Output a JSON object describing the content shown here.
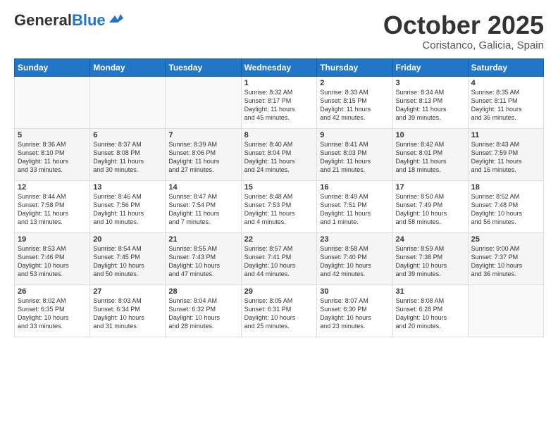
{
  "logo": {
    "general": "General",
    "blue": "Blue"
  },
  "header": {
    "month": "October 2025",
    "location": "Coristanco, Galicia, Spain"
  },
  "weekdays": [
    "Sunday",
    "Monday",
    "Tuesday",
    "Wednesday",
    "Thursday",
    "Friday",
    "Saturday"
  ],
  "weeks": [
    [
      {
        "day": "",
        "info": ""
      },
      {
        "day": "",
        "info": ""
      },
      {
        "day": "",
        "info": ""
      },
      {
        "day": "1",
        "info": "Sunrise: 8:32 AM\nSunset: 8:17 PM\nDaylight: 11 hours\nand 45 minutes."
      },
      {
        "day": "2",
        "info": "Sunrise: 8:33 AM\nSunset: 8:15 PM\nDaylight: 11 hours\nand 42 minutes."
      },
      {
        "day": "3",
        "info": "Sunrise: 8:34 AM\nSunset: 8:13 PM\nDaylight: 11 hours\nand 39 minutes."
      },
      {
        "day": "4",
        "info": "Sunrise: 8:35 AM\nSunset: 8:11 PM\nDaylight: 11 hours\nand 36 minutes."
      }
    ],
    [
      {
        "day": "5",
        "info": "Sunrise: 8:36 AM\nSunset: 8:10 PM\nDaylight: 11 hours\nand 33 minutes."
      },
      {
        "day": "6",
        "info": "Sunrise: 8:37 AM\nSunset: 8:08 PM\nDaylight: 11 hours\nand 30 minutes."
      },
      {
        "day": "7",
        "info": "Sunrise: 8:39 AM\nSunset: 8:06 PM\nDaylight: 11 hours\nand 27 minutes."
      },
      {
        "day": "8",
        "info": "Sunrise: 8:40 AM\nSunset: 8:04 PM\nDaylight: 11 hours\nand 24 minutes."
      },
      {
        "day": "9",
        "info": "Sunrise: 8:41 AM\nSunset: 8:03 PM\nDaylight: 11 hours\nand 21 minutes."
      },
      {
        "day": "10",
        "info": "Sunrise: 8:42 AM\nSunset: 8:01 PM\nDaylight: 11 hours\nand 18 minutes."
      },
      {
        "day": "11",
        "info": "Sunrise: 8:43 AM\nSunset: 7:59 PM\nDaylight: 11 hours\nand 16 minutes."
      }
    ],
    [
      {
        "day": "12",
        "info": "Sunrise: 8:44 AM\nSunset: 7:58 PM\nDaylight: 11 hours\nand 13 minutes."
      },
      {
        "day": "13",
        "info": "Sunrise: 8:46 AM\nSunset: 7:56 PM\nDaylight: 11 hours\nand 10 minutes."
      },
      {
        "day": "14",
        "info": "Sunrise: 8:47 AM\nSunset: 7:54 PM\nDaylight: 11 hours\nand 7 minutes."
      },
      {
        "day": "15",
        "info": "Sunrise: 8:48 AM\nSunset: 7:53 PM\nDaylight: 11 hours\nand 4 minutes."
      },
      {
        "day": "16",
        "info": "Sunrise: 8:49 AM\nSunset: 7:51 PM\nDaylight: 11 hours\nand 1 minute."
      },
      {
        "day": "17",
        "info": "Sunrise: 8:50 AM\nSunset: 7:49 PM\nDaylight: 10 hours\nand 58 minutes."
      },
      {
        "day": "18",
        "info": "Sunrise: 8:52 AM\nSunset: 7:48 PM\nDaylight: 10 hours\nand 56 minutes."
      }
    ],
    [
      {
        "day": "19",
        "info": "Sunrise: 8:53 AM\nSunset: 7:46 PM\nDaylight: 10 hours\nand 53 minutes."
      },
      {
        "day": "20",
        "info": "Sunrise: 8:54 AM\nSunset: 7:45 PM\nDaylight: 10 hours\nand 50 minutes."
      },
      {
        "day": "21",
        "info": "Sunrise: 8:55 AM\nSunset: 7:43 PM\nDaylight: 10 hours\nand 47 minutes."
      },
      {
        "day": "22",
        "info": "Sunrise: 8:57 AM\nSunset: 7:41 PM\nDaylight: 10 hours\nand 44 minutes."
      },
      {
        "day": "23",
        "info": "Sunrise: 8:58 AM\nSunset: 7:40 PM\nDaylight: 10 hours\nand 42 minutes."
      },
      {
        "day": "24",
        "info": "Sunrise: 8:59 AM\nSunset: 7:38 PM\nDaylight: 10 hours\nand 39 minutes."
      },
      {
        "day": "25",
        "info": "Sunrise: 9:00 AM\nSunset: 7:37 PM\nDaylight: 10 hours\nand 36 minutes."
      }
    ],
    [
      {
        "day": "26",
        "info": "Sunrise: 8:02 AM\nSunset: 6:35 PM\nDaylight: 10 hours\nand 33 minutes."
      },
      {
        "day": "27",
        "info": "Sunrise: 8:03 AM\nSunset: 6:34 PM\nDaylight: 10 hours\nand 31 minutes."
      },
      {
        "day": "28",
        "info": "Sunrise: 8:04 AM\nSunset: 6:32 PM\nDaylight: 10 hours\nand 28 minutes."
      },
      {
        "day": "29",
        "info": "Sunrise: 8:05 AM\nSunset: 6:31 PM\nDaylight: 10 hours\nand 25 minutes."
      },
      {
        "day": "30",
        "info": "Sunrise: 8:07 AM\nSunset: 6:30 PM\nDaylight: 10 hours\nand 23 minutes."
      },
      {
        "day": "31",
        "info": "Sunrise: 8:08 AM\nSunset: 6:28 PM\nDaylight: 10 hours\nand 20 minutes."
      },
      {
        "day": "",
        "info": ""
      }
    ]
  ]
}
